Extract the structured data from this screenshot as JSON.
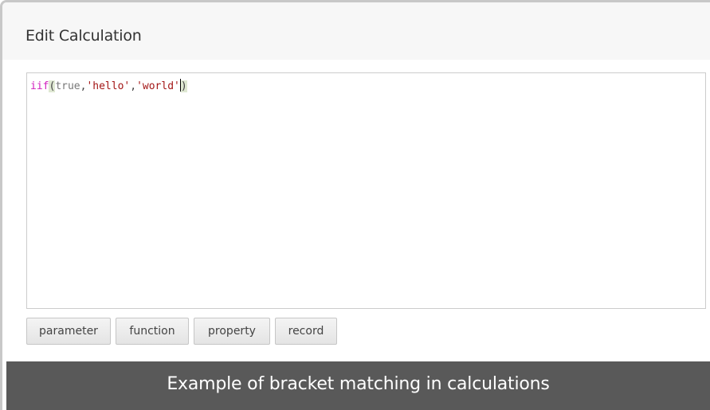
{
  "dialog": {
    "title": "Edit Calculation"
  },
  "editor": {
    "tokens": {
      "fn": "iif",
      "open_paren": "(",
      "keyword": "true",
      "comma1": ",",
      "str1": "'hello'",
      "comma2": ",",
      "str2": "'world'",
      "close_paren": ")"
    },
    "highlighted_brackets": [
      "(",
      ")"
    ]
  },
  "insert_buttons": {
    "parameter": "parameter",
    "function": "function",
    "property": "property",
    "record": "record"
  },
  "caption": {
    "text": "Example of bracket matching in calculations"
  },
  "colors": {
    "function_token": "#d11fbd",
    "string_token": "#a31515",
    "keyword_token": "#777777",
    "bracket_match_highlight": "#dfe8d2",
    "caption_background": "#595959"
  }
}
